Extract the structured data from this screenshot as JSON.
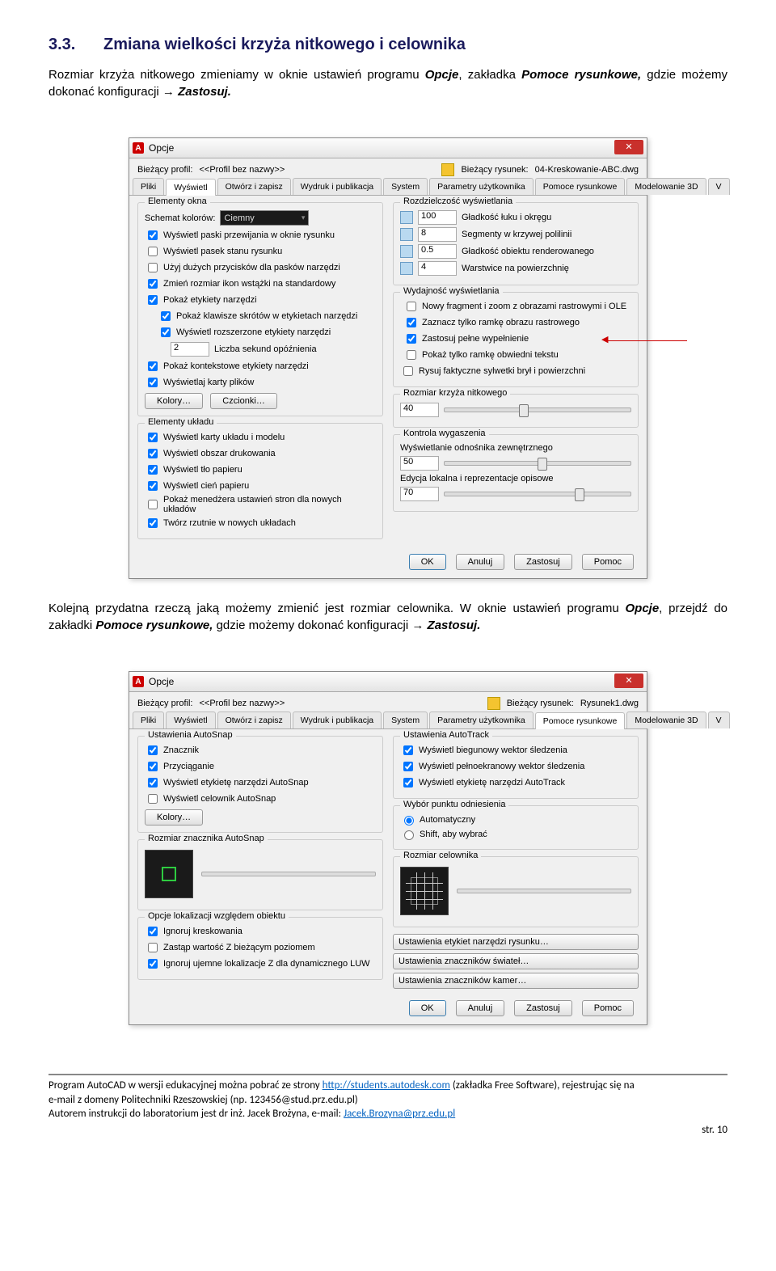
{
  "heading": {
    "num": "3.3.",
    "title": "Zmiana wielkości krzyża nitkowego i celownika"
  },
  "para1a": "Rozmiar krzyża nitkowego zmieniamy w oknie ustawień programu ",
  "para1b": "Opcje",
  "para1c": ", zakładka ",
  "para1d": "Pomoce rysunkowe,",
  "para1e": " gdzie możemy dokonać konfiguracji → ",
  "para1f": "Zastosuj.",
  "para2a": "Kolejną przydatna rzeczą jaką możemy zmienić jest rozmiar celownika. W oknie ustawień programu ",
  "para2b": "Opcje",
  "para2c": ", przejdź do zakładki ",
  "para2d": "Pomoce rysunkowe,",
  "para2e": " gdzie możemy dokonać konfiguracji → ",
  "para2f": "Zastosuj.",
  "dlg1": {
    "title": "Opcje",
    "profile_lbl": "Bieżący profil:",
    "profile_val": "<<Profil bez nazwy>>",
    "drawing_lbl": "Bieżący rysunek:",
    "drawing_val": "04-Kreskowanie-ABC.dwg",
    "tabs": [
      "Pliki",
      "Wyświetl",
      "Otwórz i zapisz",
      "Wydruk i publikacja",
      "System",
      "Parametry użytkownika",
      "Pomoce rysunkowe",
      "Modelowanie 3D",
      "V"
    ],
    "active_tab": 1,
    "g_window": "Elementy okna",
    "color_scheme_lbl": "Schemat kolorów:",
    "color_scheme_val": "Ciemny",
    "checks1": [
      {
        "c": true,
        "t": "Wyświetl paski przewijania w oknie rysunku"
      },
      {
        "c": false,
        "t": "Wyświetl pasek stanu rysunku"
      },
      {
        "c": false,
        "t": "Użyj dużych przycisków dla pasków narzędzi"
      },
      {
        "c": true,
        "t": "Zmień rozmiar ikon wstążki na standardowy"
      },
      {
        "c": true,
        "t": "Pokaż etykiety narzędzi"
      }
    ],
    "sub1": [
      {
        "c": true,
        "t": "Pokaż klawisze skrótów w etykietach narzędzi"
      },
      {
        "c": true,
        "t": "Wyświetl rozszerzone etykiety narzędzi"
      }
    ],
    "delay_val": "2",
    "delay_lbl": "Liczba sekund opóźnienia",
    "checks1b": [
      {
        "c": true,
        "t": "Pokaż kontekstowe etykiety narzędzi"
      },
      {
        "c": true,
        "t": "Wyświetlaj karty plików"
      }
    ],
    "btn_colors": "Kolory…",
    "btn_fonts": "Czcionki…",
    "g_layout": "Elementy układu",
    "checks2": [
      {
        "c": true,
        "t": "Wyświetl karty układu i modelu"
      },
      {
        "c": true,
        "t": "Wyświetl obszar drukowania"
      },
      {
        "c": true,
        "t": "Wyświetl tło papieru"
      },
      {
        "c": true,
        "t": "Wyświetl cień papieru"
      },
      {
        "c": false,
        "t": "Pokaż menedżera ustawień stron dla nowych układów"
      },
      {
        "c": true,
        "t": "Twórz rzutnie w nowych układach"
      }
    ],
    "g_res": "Rozdzielczość wyświetlania",
    "res": [
      {
        "v": "100",
        "t": "Gładkość łuku i okręgu"
      },
      {
        "v": "8",
        "t": "Segmenty w krzywej polilinii"
      },
      {
        "v": "0.5",
        "t": "Gładkość obiektu renderowanego"
      },
      {
        "v": "4",
        "t": "Warstwice na powierzchnię"
      }
    ],
    "g_perf": "Wydajność wyświetlania",
    "perf": [
      {
        "c": false,
        "t": "Nowy fragment i zoom z obrazami rastrowymi i OLE"
      },
      {
        "c": true,
        "t": "Zaznacz tylko ramkę obrazu rastrowego"
      },
      {
        "c": true,
        "t": "Zastosuj pełne wypełnienie"
      },
      {
        "c": false,
        "t": "Pokaż tylko ramkę obwiedni tekstu"
      },
      {
        "c": false,
        "t": "Rysuj faktyczne sylwetki brył i powierzchni"
      }
    ],
    "g_cross": "Rozmiar krzyża nitkowego",
    "cross_val": "40",
    "g_fade": "Kontrola wygaszenia",
    "fade1_lbl": "Wyświetlanie odnośnika zewnętrznego",
    "fade1_val": "50",
    "fade2_lbl": "Edycja lokalna i reprezentacje opisowe",
    "fade2_val": "70",
    "ok": "OK",
    "cancel": "Anuluj",
    "apply": "Zastosuj",
    "help": "Pomoc"
  },
  "dlg2": {
    "title": "Opcje",
    "profile_lbl": "Bieżący profil:",
    "profile_val": "<<Profil bez nazwy>>",
    "drawing_lbl": "Bieżący rysunek:",
    "drawing_val": "Rysunek1.dwg",
    "tabs": [
      "Pliki",
      "Wyświetl",
      "Otwórz i zapisz",
      "Wydruk i publikacja",
      "System",
      "Parametry użytkownika",
      "Pomoce rysunkowe",
      "Modelowanie 3D",
      "V"
    ],
    "active_tab": 6,
    "g_as": "Ustawienia AutoSnap",
    "as": [
      {
        "c": true,
        "t": "Znacznik"
      },
      {
        "c": true,
        "t": "Przyciąganie"
      },
      {
        "c": true,
        "t": "Wyświetl etykietę narzędzi AutoSnap"
      },
      {
        "c": false,
        "t": "Wyświetl celownik AutoSnap"
      }
    ],
    "btn_colors": "Kolory…",
    "g_as_size": "Rozmiar znacznika AutoSnap",
    "g_loc": "Opcje lokalizacji względem obiektu",
    "loc": [
      {
        "c": true,
        "t": "Ignoruj kreskowania"
      },
      {
        "c": false,
        "t": "Zastąp wartość Z bieżącym poziomem"
      },
      {
        "c": true,
        "t": "Ignoruj ujemne lokalizacje Z dla dynamicznego LUW"
      }
    ],
    "g_at": "Ustawienia AutoTrack",
    "at": [
      {
        "c": true,
        "t": "Wyświetl biegunowy wektor śledzenia"
      },
      {
        "c": true,
        "t": "Wyświetl pełnoekranowy wektor śledzenia"
      },
      {
        "c": true,
        "t": "Wyświetl etykietę narzędzi AutoTrack"
      }
    ],
    "g_pt": "Wybór punktu odniesienia",
    "pt": [
      {
        "c": true,
        "t": "Automatyczny"
      },
      {
        "c": false,
        "t": "Shift, aby wybrać"
      }
    ],
    "g_aim": "Rozmiar celownika",
    "btns": [
      "Ustawienia etykiet narzędzi rysunku…",
      "Ustawienia znaczników świateł…",
      "Ustawienia znaczników kamer…"
    ],
    "ok": "OK",
    "cancel": "Anuluj",
    "apply": "Zastosuj",
    "help": "Pomoc"
  },
  "footer": {
    "l1a": "Program AutoCAD w wersji edukacyjnej można pobrać ze strony ",
    "l1b": "http://students.autodesk.com",
    "l1c": " (zakładka Free Software), rejestrując się na",
    "l2": "e-mail z domeny Politechniki Rzeszowskiej (np. 123456@stud.prz.edu.pl)",
    "l3a": "Autorem instrukcji do laboratorium jest dr inż. Jacek Brożyna, e-mail: ",
    "l3b": "Jacek.Brozyna@prz.edu.pl",
    "pg": "str. 10"
  }
}
